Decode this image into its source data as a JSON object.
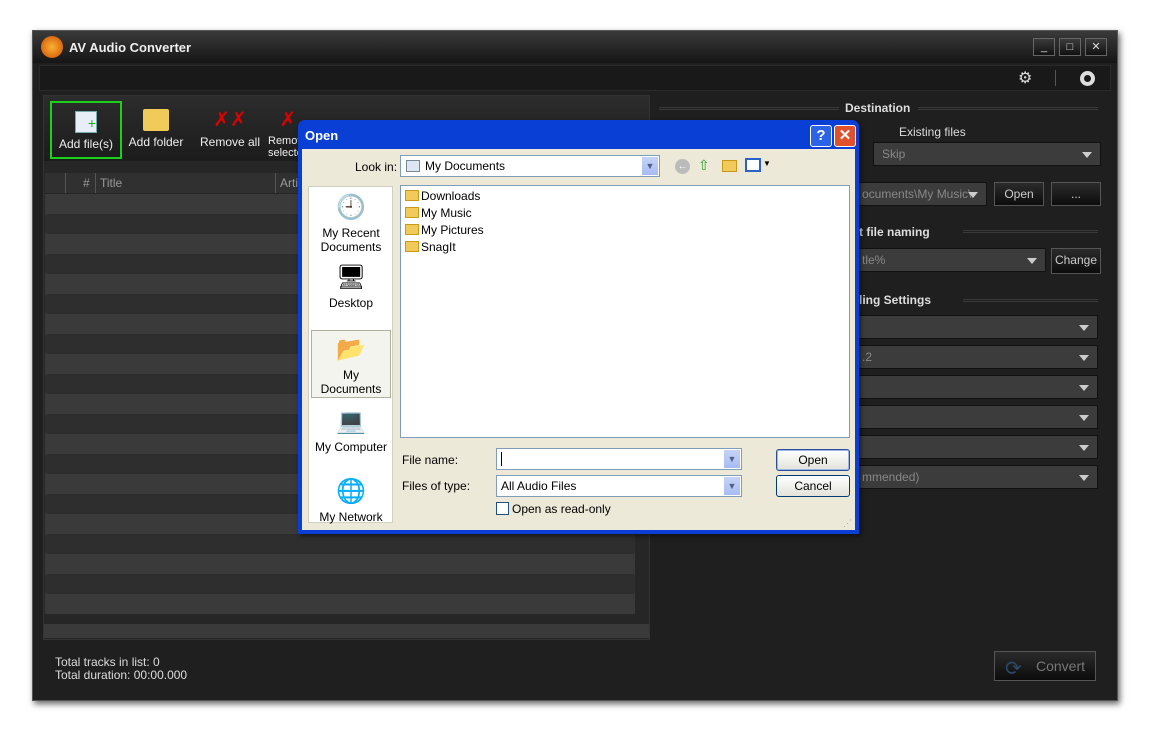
{
  "window": {
    "title": "AV Audio Converter",
    "minimize": "_",
    "maximize": "□",
    "close": "✕"
  },
  "topbar": {
    "settings_icon": "gears-icon",
    "help_icon": "lifebuoy-icon"
  },
  "toolbar": {
    "items": [
      {
        "label": "Add file(s)",
        "icon": "add-file-icon"
      },
      {
        "label": "Add folder",
        "icon": "add-folder-icon"
      },
      {
        "label": "Remove all",
        "icon": "remove-all-icon"
      },
      {
        "label": "Remove selected",
        "icon": "remove-selected-icon",
        "visible": "Rem\nselec"
      }
    ]
  },
  "list": {
    "columns": [
      "#",
      "Title",
      "Artis"
    ]
  },
  "status": {
    "tracks": "Total tracks in list: 0",
    "duration": "Total duration: 00:00.000"
  },
  "destination": {
    "heading": "Destination",
    "existing_label": "Existing files",
    "existing_value": "Skip",
    "path": "ocuments\\My Music\\",
    "open": "Open",
    "browse": "..."
  },
  "naming": {
    "heading": "t file naming",
    "value": "tle%",
    "change": "Change"
  },
  "encoding": {
    "heading": "ling Settings",
    "values": [
      "",
      ".2",
      "",
      "",
      "",
      "mmended)"
    ]
  },
  "convert": {
    "label": "Convert"
  },
  "dialog": {
    "title": "Open",
    "help": "?",
    "close": "✕",
    "look_in_label": "Look in:",
    "look_in_value": "My Documents",
    "places": [
      "My Recent Documents",
      "Desktop",
      "My Documents",
      "My Computer",
      "My Network"
    ],
    "files": [
      "Downloads",
      "My Music",
      "My Pictures",
      "SnagIt"
    ],
    "file_name_label": "File name:",
    "file_name_value": "",
    "files_of_type_label": "Files of type:",
    "files_of_type_value": "All Audio Files",
    "read_only_label": "Open as read-only",
    "read_only_checked": false,
    "open": "Open",
    "cancel": "Cancel"
  }
}
